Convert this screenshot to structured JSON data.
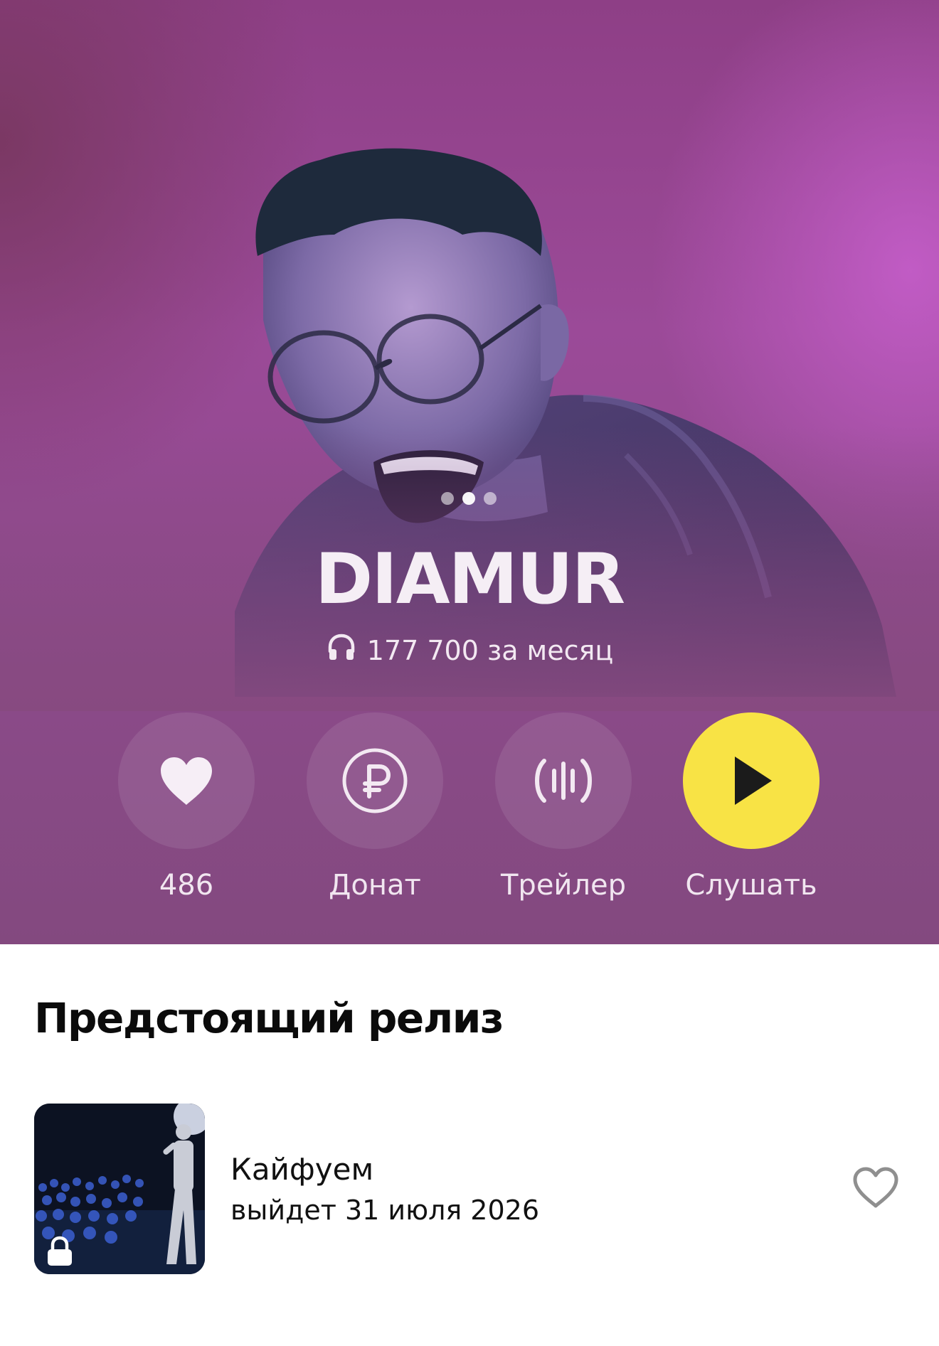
{
  "artist": {
    "name": "DIAMUR",
    "listeners": "177 700 за месяц"
  },
  "carousel": {
    "count": 3,
    "active": 2
  },
  "actions": [
    {
      "id": "like",
      "label": "486",
      "icon": "heart-icon"
    },
    {
      "id": "donate",
      "label": "Донат",
      "icon": "ruble-icon"
    },
    {
      "id": "trailer",
      "label": "Трейлер",
      "icon": "waveform-icon"
    },
    {
      "id": "listen",
      "label": "Слушать",
      "icon": "play-icon"
    }
  ],
  "colors": {
    "hero_background": "#8e3f86",
    "play_button": "#f8e345",
    "text_light": "#f3e9f2"
  },
  "upcoming": {
    "section_title": "Предстоящий релиз",
    "release": {
      "title": "Кайфуем",
      "date": "выйдет 31 июля 2026",
      "locked": true,
      "like_icon": "heart-outline-icon"
    }
  }
}
